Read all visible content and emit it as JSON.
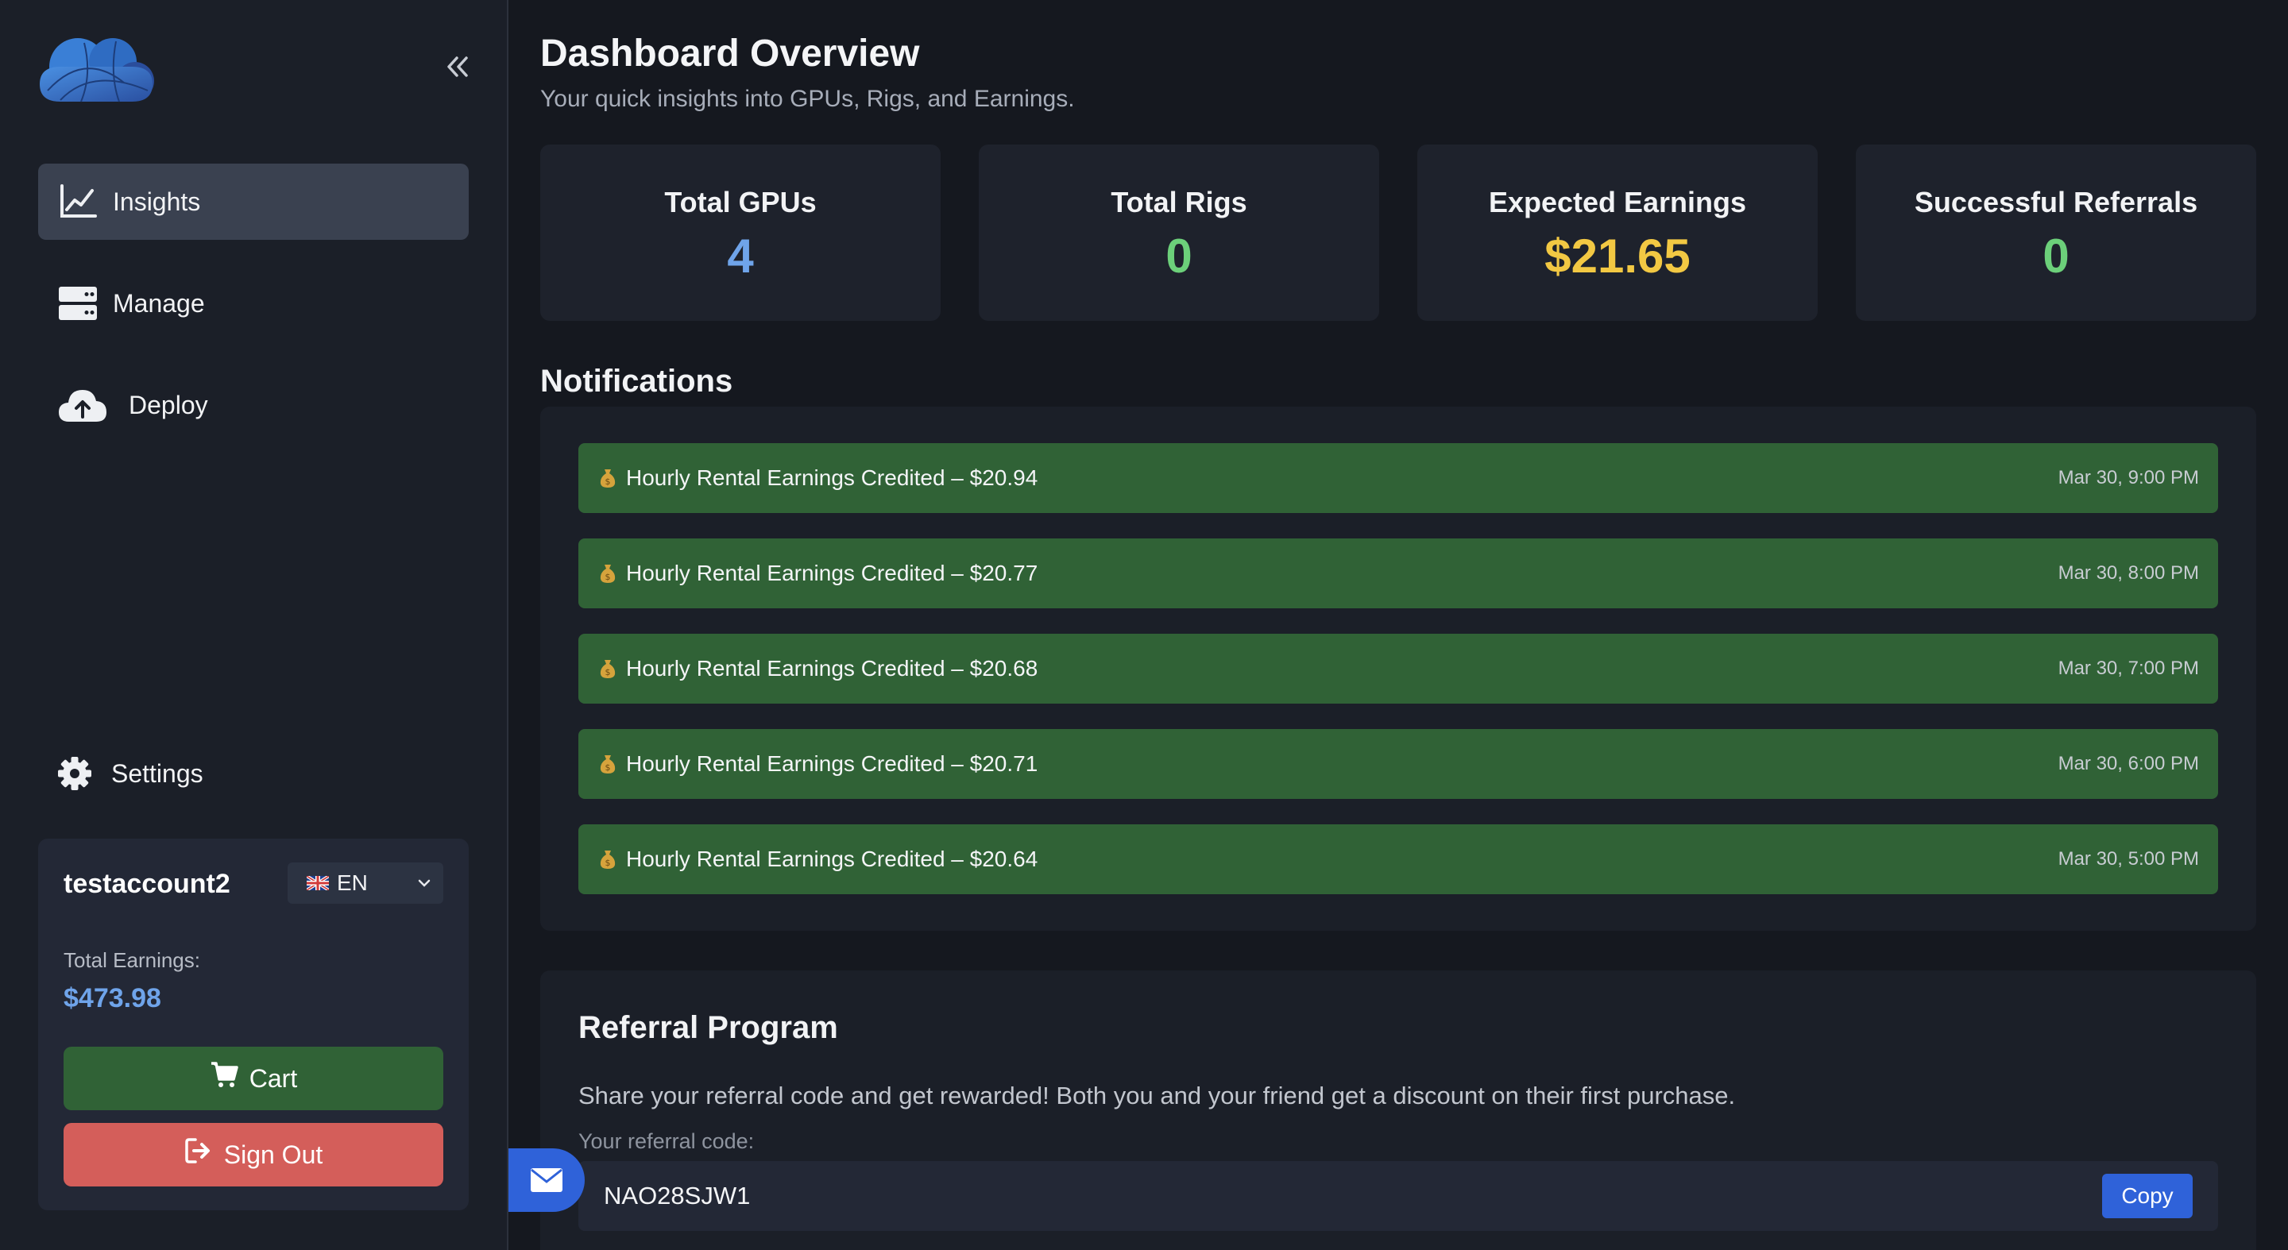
{
  "sidebar": {
    "nav": [
      {
        "label": "Insights",
        "icon": "chart-line-icon",
        "active": true
      },
      {
        "label": "Manage",
        "icon": "server-icon"
      },
      {
        "label": "Deploy",
        "icon": "cloud-upload-icon"
      }
    ],
    "settings_label": "Settings",
    "account": {
      "username": "testaccount2",
      "language": "EN",
      "earnings_label": "Total Earnings:",
      "earnings_value": "$473.98",
      "cart_label": "Cart",
      "signout_label": "Sign Out"
    }
  },
  "header": {
    "title": "Dashboard Overview",
    "subtitle": "Your quick insights into GPUs, Rigs, and Earnings."
  },
  "stats": [
    {
      "label": "Total GPUs",
      "value": "4",
      "color": "#6fa4ea"
    },
    {
      "label": "Total Rigs",
      "value": "0",
      "color": "#6cd07a"
    },
    {
      "label": "Expected Earnings",
      "value": "$21.65",
      "color": "#f2c843"
    },
    {
      "label": "Successful Referrals",
      "value": "0",
      "color": "#6cd07a"
    }
  ],
  "notifications": {
    "title": "Notifications",
    "items": [
      {
        "text": "Hourly Rental Earnings Credited – $20.94",
        "time": "Mar 30, 9:00 PM"
      },
      {
        "text": "Hourly Rental Earnings Credited – $20.77",
        "time": "Mar 30, 8:00 PM"
      },
      {
        "text": "Hourly Rental Earnings Credited – $20.68",
        "time": "Mar 30, 7:00 PM"
      },
      {
        "text": "Hourly Rental Earnings Credited – $20.71",
        "time": "Mar 30, 6:00 PM"
      },
      {
        "text": "Hourly Rental Earnings Credited – $20.64",
        "time": "Mar 30, 5:00 PM"
      }
    ]
  },
  "referral": {
    "title": "Referral Program",
    "description": "Share your referral code and get rewarded! Both you and your friend get a discount on their first purchase.",
    "code_label": "Your referral code:",
    "code": "NAO28SJW1",
    "copy_label": "Copy"
  }
}
